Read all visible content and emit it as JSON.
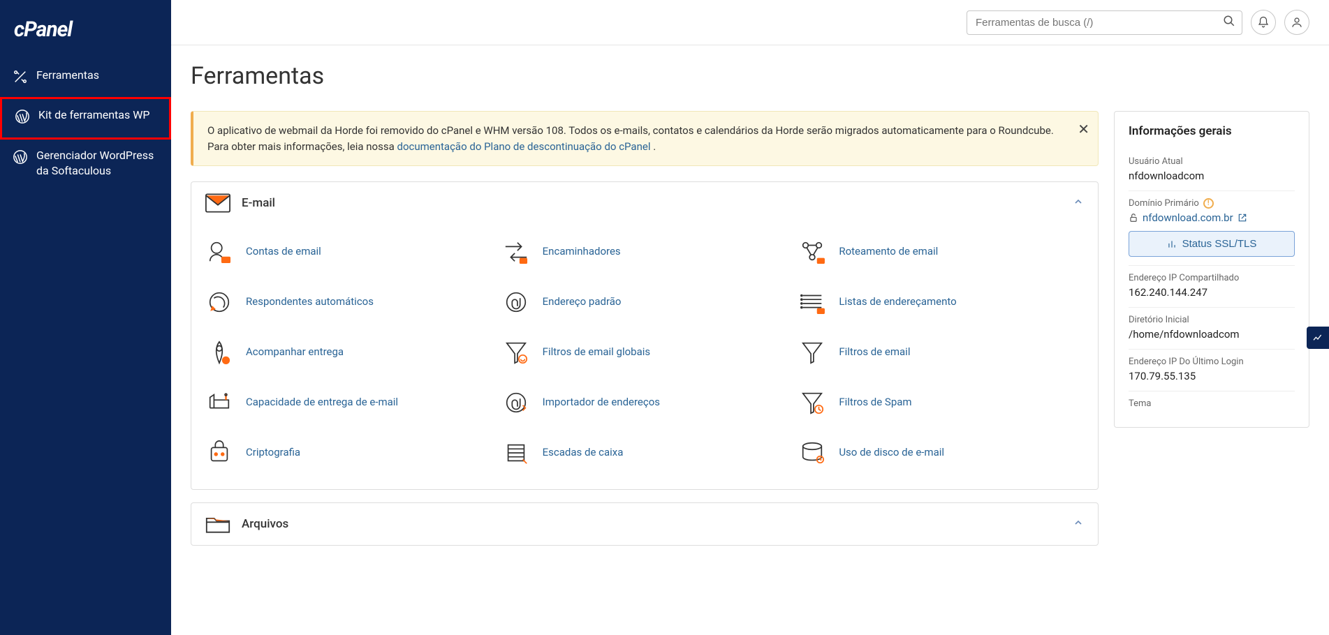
{
  "logo_text": "cPanel",
  "search": {
    "placeholder": "Ferramentas de busca (/)"
  },
  "sidebar": {
    "items": [
      {
        "label": "Ferramentas"
      },
      {
        "label": "Kit de ferramentas WP"
      },
      {
        "label": "Gerenciador WordPress da Softaculous"
      }
    ]
  },
  "page": {
    "title": "Ferramentas"
  },
  "alert": {
    "text_pre": "O aplicativo de webmail da Horde foi removido do cPanel e WHM versão 108. Todos os e-mails, contatos e calendários da Horde serão migrados automaticamente para o Roundcube. Para obter mais informações, leia nossa ",
    "link_text": "documentação do Plano de descontinuação do cPanel",
    "text_post": " ."
  },
  "groups": {
    "email": {
      "title": "E-mail",
      "items": [
        "Contas de email",
        "Encaminhadores",
        "Roteamento de email",
        "Respondentes automáticos",
        "Endereço padrão",
        "Listas de endereçamento",
        "Acompanhar entrega",
        "Filtros de email globais",
        "Filtros de email",
        "Capacidade de entrega de e-mail",
        "Importador de endereços",
        "Filtros de Spam",
        "Criptografia",
        "Escadas de caixa",
        "Uso de disco de e-mail"
      ]
    },
    "files": {
      "title": "Arquivos"
    }
  },
  "info": {
    "heading": "Informações gerais",
    "rows": {
      "current_user": {
        "label": "Usuário Atual",
        "value": "nfdownloadcom"
      },
      "primary_domain": {
        "label": "Domínio Primário",
        "value": "nfdownload.com.br"
      },
      "ssl_button": "Status SSL/TLS",
      "shared_ip": {
        "label": "Endereço IP Compartilhado",
        "value": "162.240.144.247"
      },
      "home_dir": {
        "label": "Diretório Inicial",
        "value": "/home/nfdownloadcom"
      },
      "last_login_ip": {
        "label": "Endereço IP Do Último Login",
        "value": "170.79.55.135"
      },
      "theme": {
        "label": "Tema"
      }
    }
  }
}
